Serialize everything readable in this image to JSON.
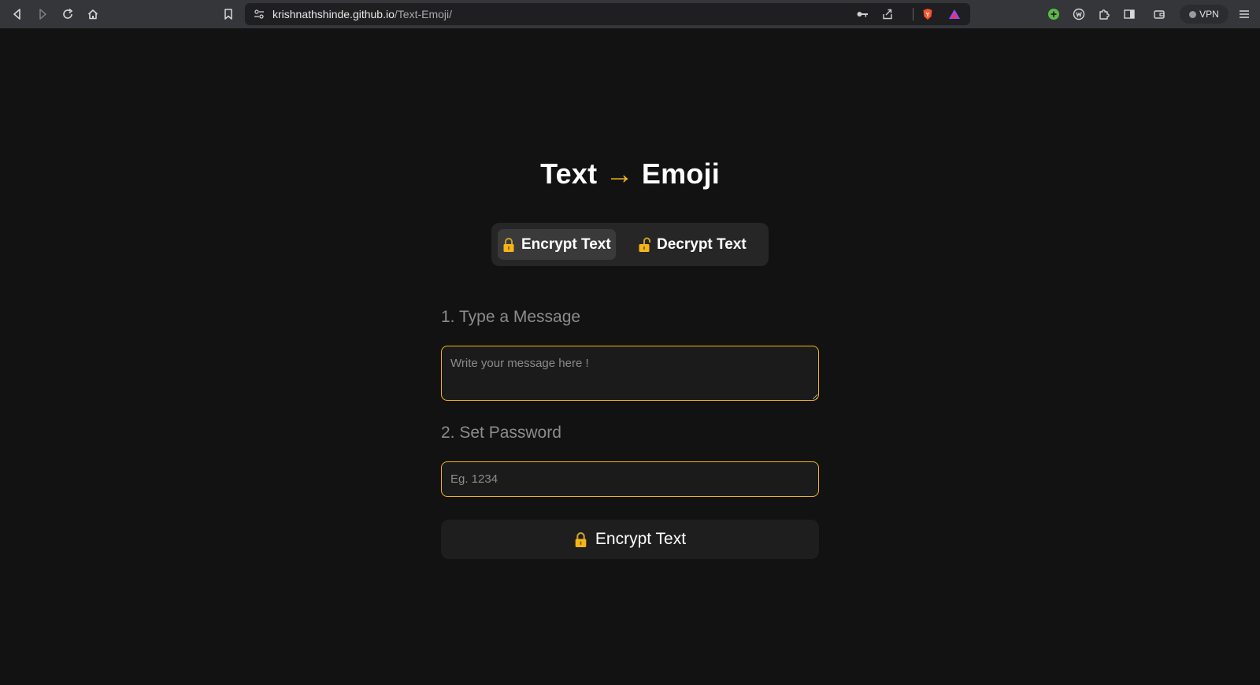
{
  "browser": {
    "url_host": "krishnathshinde.github.io",
    "url_path": "/Text-Emoji/",
    "vpn_label": "VPN"
  },
  "page": {
    "title_left": "Text",
    "title_arrow": "→",
    "title_right": "Emoji",
    "tabs": [
      {
        "label": "Encrypt Text",
        "icon": "lock-closed-icon",
        "active": true
      },
      {
        "label": "Decrypt Text",
        "icon": "lock-open-icon",
        "active": false
      }
    ],
    "message_label": "1. Type a Message",
    "message_placeholder": "Write your message here !",
    "password_label": "2. Set Password",
    "password_placeholder": "Eg. 1234",
    "submit_label": "Encrypt Text",
    "accent_color": "#f4b41a"
  }
}
